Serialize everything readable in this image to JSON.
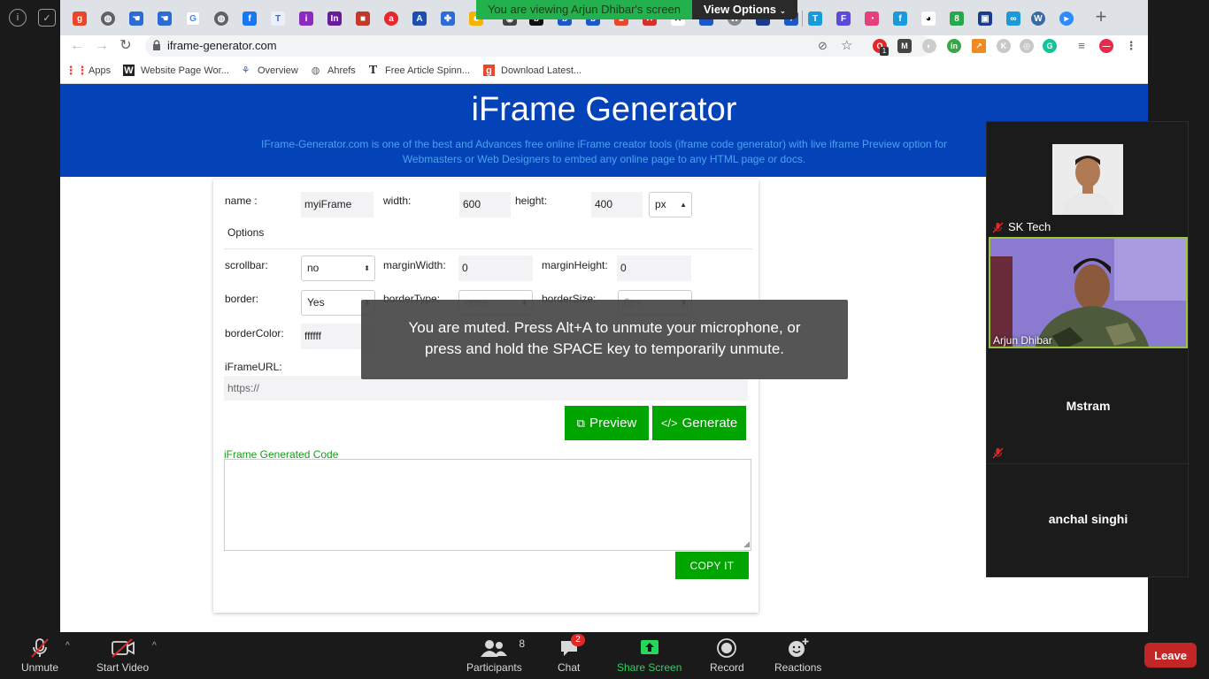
{
  "zoom": {
    "banner_text": "You are viewing Arjun Dhibar's screen",
    "view_options": "View Options",
    "muted_message_line1": "You are muted. Press Alt+A to unmute your microphone, or",
    "muted_message_line2": "press and hold the SPACE key to temporarily unmute.",
    "participants": [
      {
        "name": "SK Tech",
        "muted": true
      },
      {
        "name": "Arjun Dhibar",
        "muted": false,
        "active_speaker": true
      },
      {
        "name": "Mstram",
        "muted": true
      },
      {
        "name": "anchal singhi",
        "muted": false
      }
    ],
    "controls": {
      "unmute": "Unmute",
      "start_video": "Start Video",
      "participants": "Participants",
      "participants_count": "8",
      "chat": "Chat",
      "chat_badge": "2",
      "share_screen": "Share Screen",
      "record": "Record",
      "reactions": "Reactions",
      "leave": "Leave"
    },
    "colors": {
      "leave": "#c22626",
      "share": "#23d959",
      "banner": "#23b14d"
    }
  },
  "browser": {
    "url": "iframe-generator.com",
    "bookmarks": [
      {
        "label": "Apps",
        "icon": "apps-grid-icon"
      },
      {
        "label": "Website Page Wor...",
        "icon": "w-icon"
      },
      {
        "label": "Overview",
        "icon": "overview-icon"
      },
      {
        "label": "Ahrefs",
        "icon": "globe-icon"
      },
      {
        "label": "Free Article Spinn...",
        "icon": "t-icon"
      },
      {
        "label": "Download Latest...",
        "icon": "g-icon"
      }
    ],
    "ext_badge": "1"
  },
  "page": {
    "title": "iFrame Generator",
    "subtitle_line1": "IFrame-Generator.com is one of the best and Advances free online iFrame creator tools (iframe code generator) with live iframe Preview option for",
    "subtitle_line2": "Webmasters or Web Designers to embed any online page to any HTML page or docs.",
    "form": {
      "name_label": "name :",
      "name_value": "myiFrame",
      "width_label": "width:",
      "width_value": "600",
      "height_label": "height:",
      "height_value": "400",
      "unit_value": "px",
      "options_heading": "Options",
      "scrollbar_label": "scrollbar:",
      "scrollbar_value": "no",
      "margin_width_label": "marginWidth:",
      "margin_width_value": "0",
      "margin_height_label": "marginHeight:",
      "margin_height_value": "0",
      "border_label": "border:",
      "border_value": "Yes",
      "border_type_label": "borderType:",
      "border_type_value": "none",
      "border_size_label": "borderSize:",
      "border_size_value": "0px",
      "border_color_label": "borderColor:",
      "border_color_value": "ffffff",
      "iframe_url_label": "iFrameURL:",
      "iframe_url_value": "https://",
      "preview_button": "Preview",
      "generate_button": "Generate",
      "generated_label": "iFrame Generated Code",
      "copy_button": "COPY IT"
    }
  }
}
